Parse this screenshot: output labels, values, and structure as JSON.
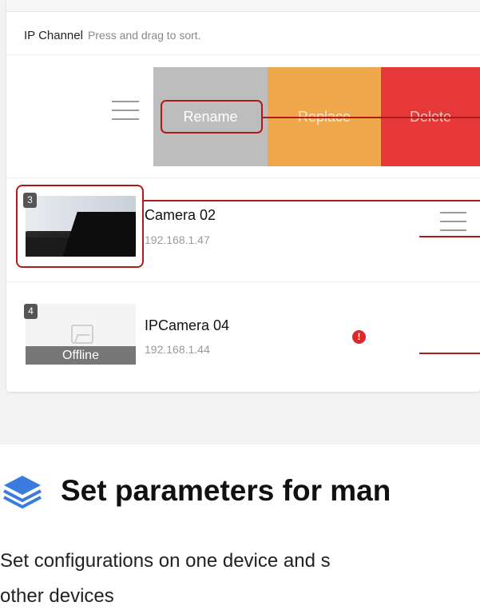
{
  "channel_list": {
    "header_title": "IP Channel",
    "header_hint": "Press and drag to sort.",
    "actions": {
      "rename": "Rename",
      "replace": "Replace",
      "delete": "Delete"
    },
    "channels": [
      {
        "number": "3",
        "name": "Camera 02",
        "ip": "192.168.1.47"
      },
      {
        "number": "4",
        "name": "IPCamera 04",
        "ip": "192.168.1.44",
        "status": "Offline",
        "warning_icon": "alert-icon"
      }
    ]
  },
  "section": {
    "icon": "layers-icon",
    "heading": "Set parameters for man",
    "body_line1": "Set configurations on one device and s",
    "body_line2": "other devices"
  },
  "colors": {
    "rename_bg": "#bdbdbd",
    "replace_bg": "#efa84c",
    "delete_bg": "#e63838",
    "highlight": "#b11a1a",
    "icon_blue": "#3a7be0"
  }
}
